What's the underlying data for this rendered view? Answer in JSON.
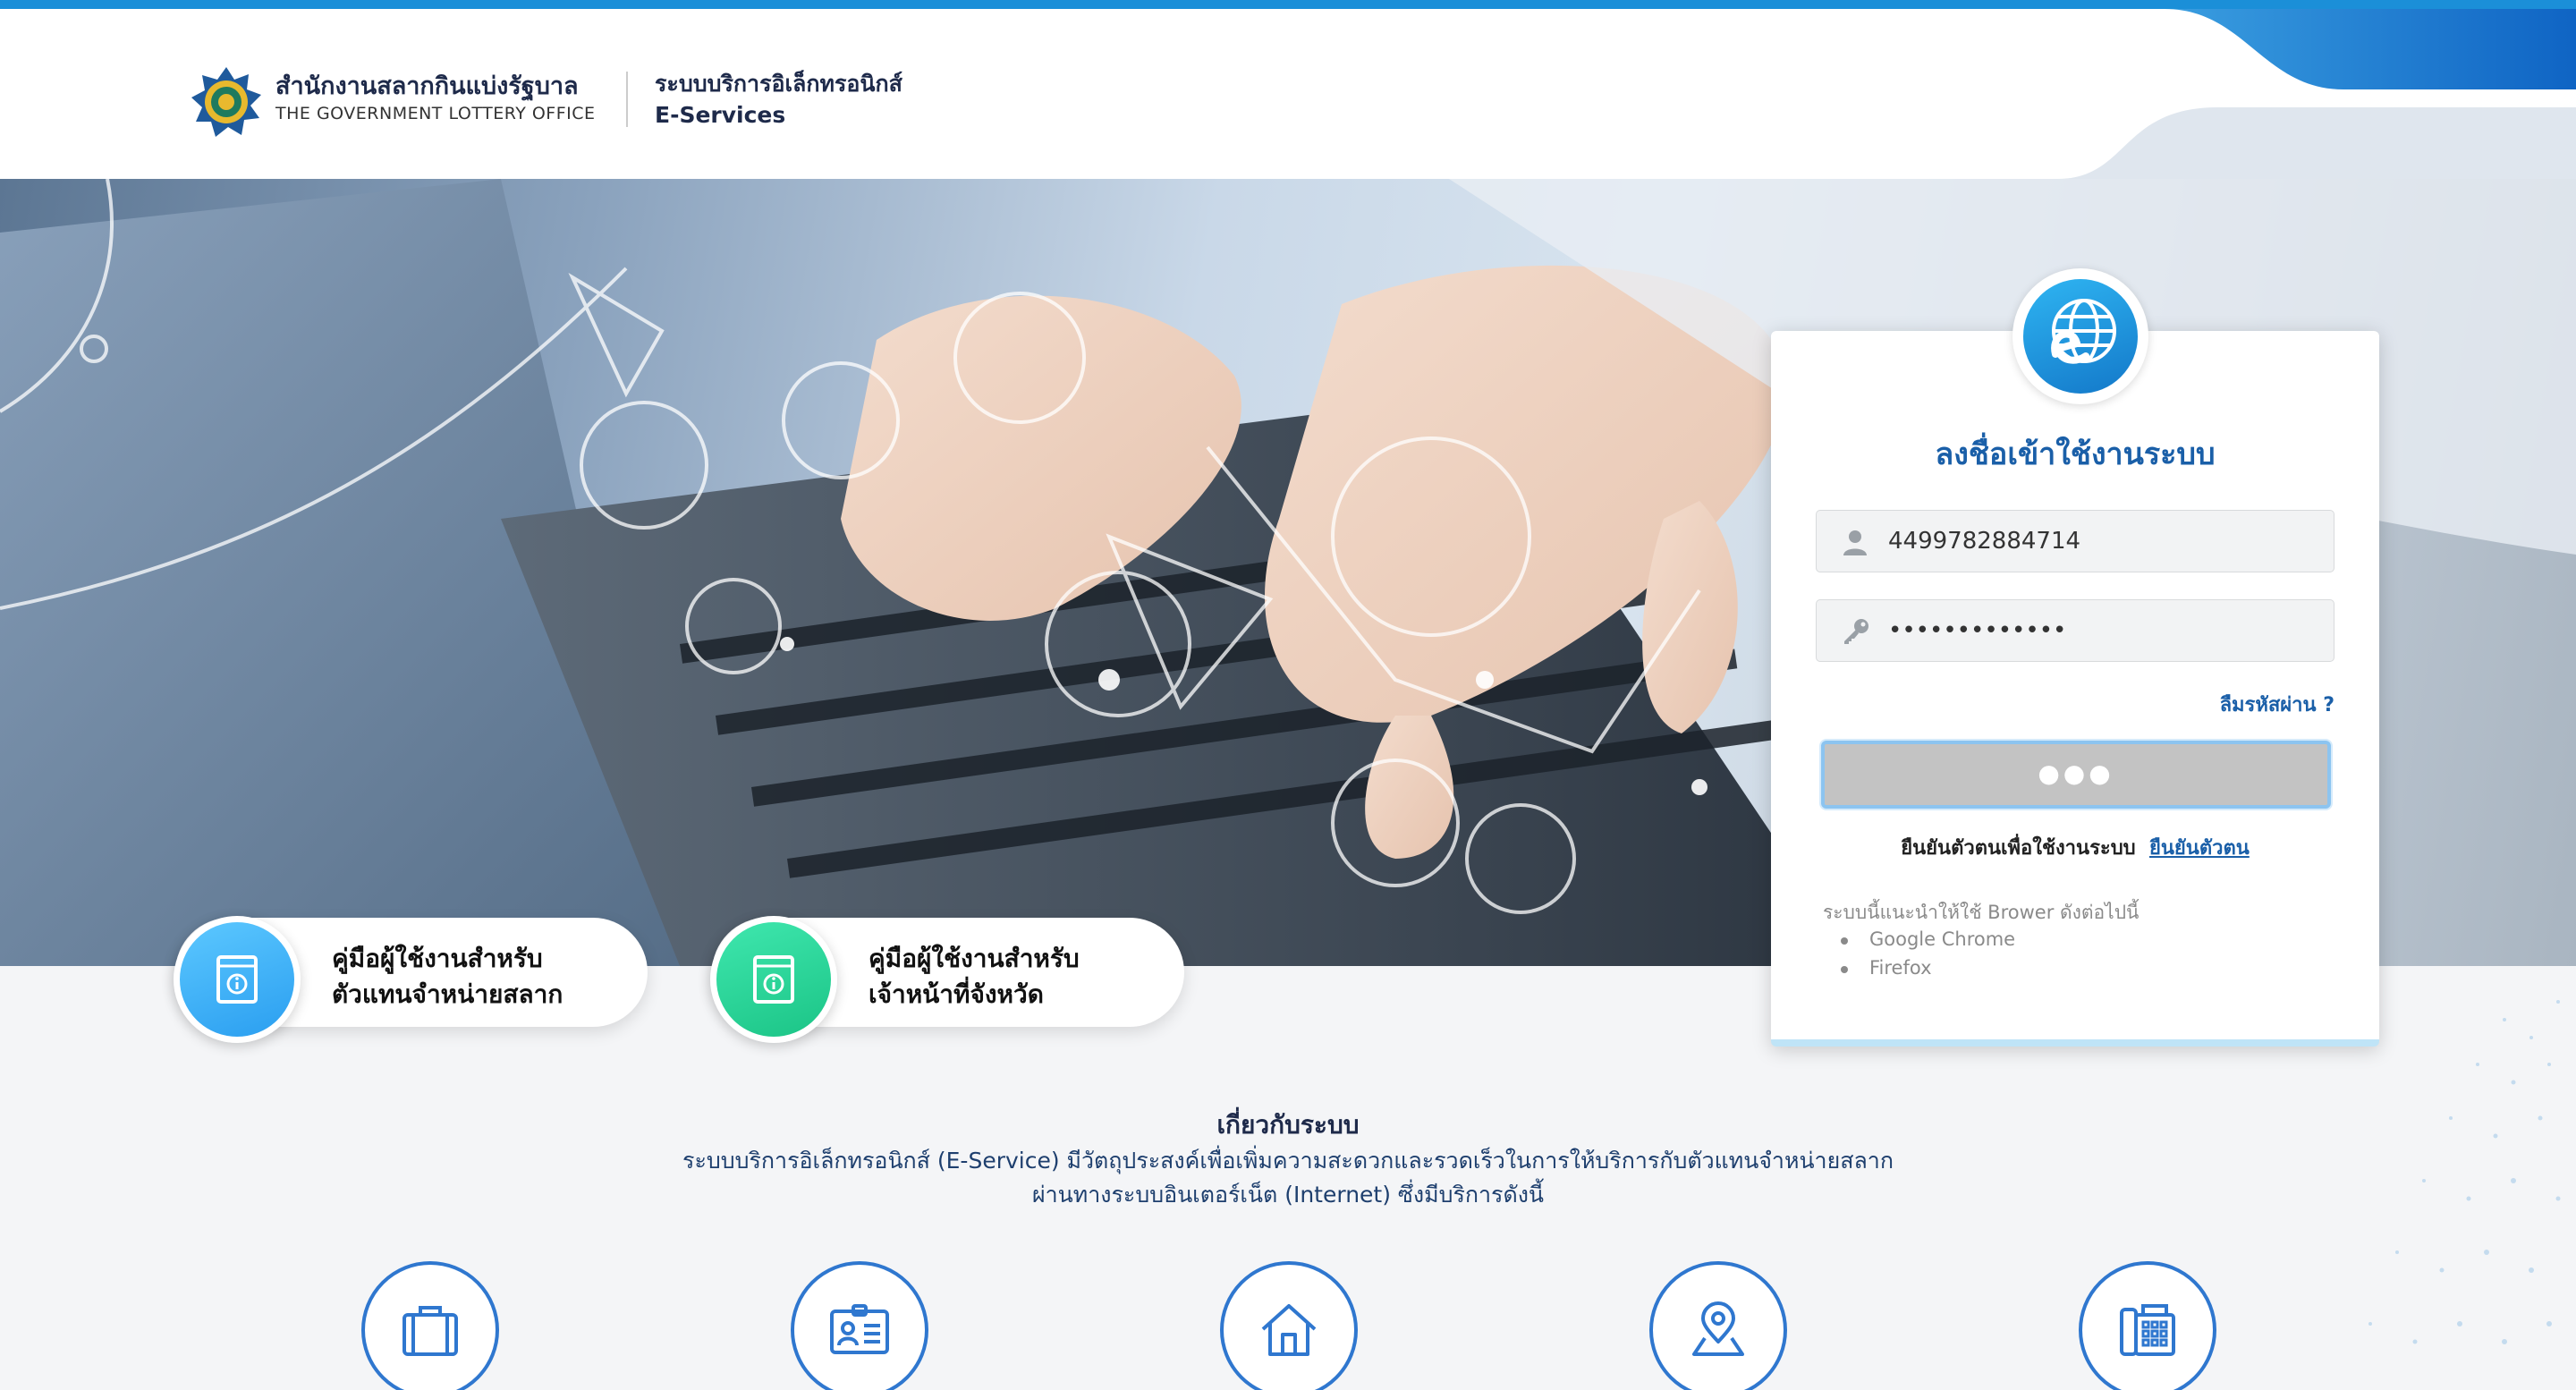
{
  "header": {
    "org_name_th": "สำนักงานสลากกินแบ่งรัฐบาล",
    "org_name_en": "THE GOVERNMENT LOTTERY OFFICE",
    "system_name_th": "ระบบบริการอิเล็กทรอนิกส์",
    "system_name_en": "E-Services",
    "logo_icon": "lottery-office-seal-icon"
  },
  "guides": [
    {
      "line1": "คู่มือผู้ใช้งานสำหรับ",
      "line2": "ตัวแทนจำหน่ายสลาก",
      "color": "#3ab0f5",
      "icon": "manual-book-icon"
    },
    {
      "line1": "คู่มือผู้ใช้งานสำหรับ",
      "line2": "เจ้าหน้าที่จังหวัด",
      "color": "#26d49a",
      "icon": "manual-book-icon"
    }
  ],
  "login": {
    "logo_icon": "e-service-globe-icon",
    "title": "ลงชื่อเข้าใช้งานระบบ",
    "username_value": "4499782884714",
    "password_value": "•••••••••••••",
    "forgot_password": "ลืมรหัสผ่าน ?",
    "submit_label": "●●●",
    "verify_text": "ยืนยันตัวตนเพื่อใช้งานระบบ",
    "verify_link": "ยืนยันตัวตน",
    "browser_note": "ระบบนี้แนะนำให้ใช้ Brower ดังต่อไปนี้",
    "browsers": [
      "Google Chrome",
      "Firefox"
    ]
  },
  "about": {
    "title": "เกี่ยวกับระบบ",
    "line1": "ระบบบริการอิเล็กทรอนิกส์ (E-Service) มีวัตถุประสงค์เพื่อเพิ่มความสะดวกและรวดเร็วในการให้บริการกับตัวแทนจำหน่ายสลาก",
    "line2": "ผ่านทางระบบอินเตอร์เน็ต (Internet) ซึ่งมีบริการดังนี้"
  },
  "services": [
    "briefcase-icon",
    "id-card-icon",
    "home-icon",
    "map-pin-icon",
    "phone-fax-icon"
  ],
  "colors": {
    "primary": "#1a5fa8",
    "accent": "#1b8fd8",
    "icon_blue": "#2f77cf"
  }
}
